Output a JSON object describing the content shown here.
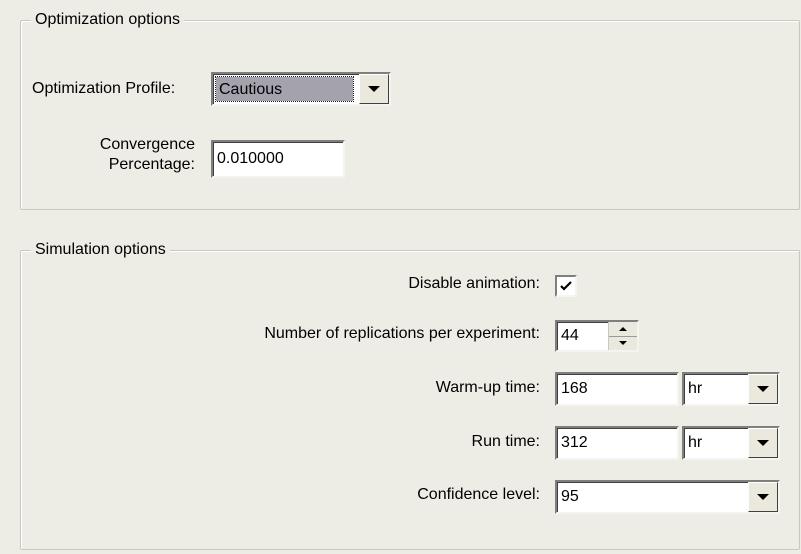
{
  "optimization": {
    "legend": "Optimization options",
    "profile_label": "Optimization Profile:",
    "profile_value": "Cautious",
    "convergence_label_line1": "Convergence",
    "convergence_label_line2": "Percentage:",
    "convergence_value": "0.010000"
  },
  "simulation": {
    "legend": "Simulation options",
    "disable_animation_label": "Disable animation:",
    "disable_animation_checked": true,
    "replications_label": "Number of replications per experiment:",
    "replications_value": "44",
    "warmup_label": "Warm-up time:",
    "warmup_value": "168",
    "warmup_unit": "hr",
    "runtime_label": "Run time:",
    "runtime_value": "312",
    "runtime_unit": "hr",
    "confidence_label": "Confidence level:",
    "confidence_value": "95"
  },
  "icons": {
    "dropdown": "chevron-down-icon",
    "spinner_up": "spinner-up-icon",
    "spinner_down": "spinner-down-icon",
    "check": "check-icon"
  },
  "colors": {
    "panel_background": "#eeede5",
    "selection_highlight": "#a4a3ad"
  }
}
